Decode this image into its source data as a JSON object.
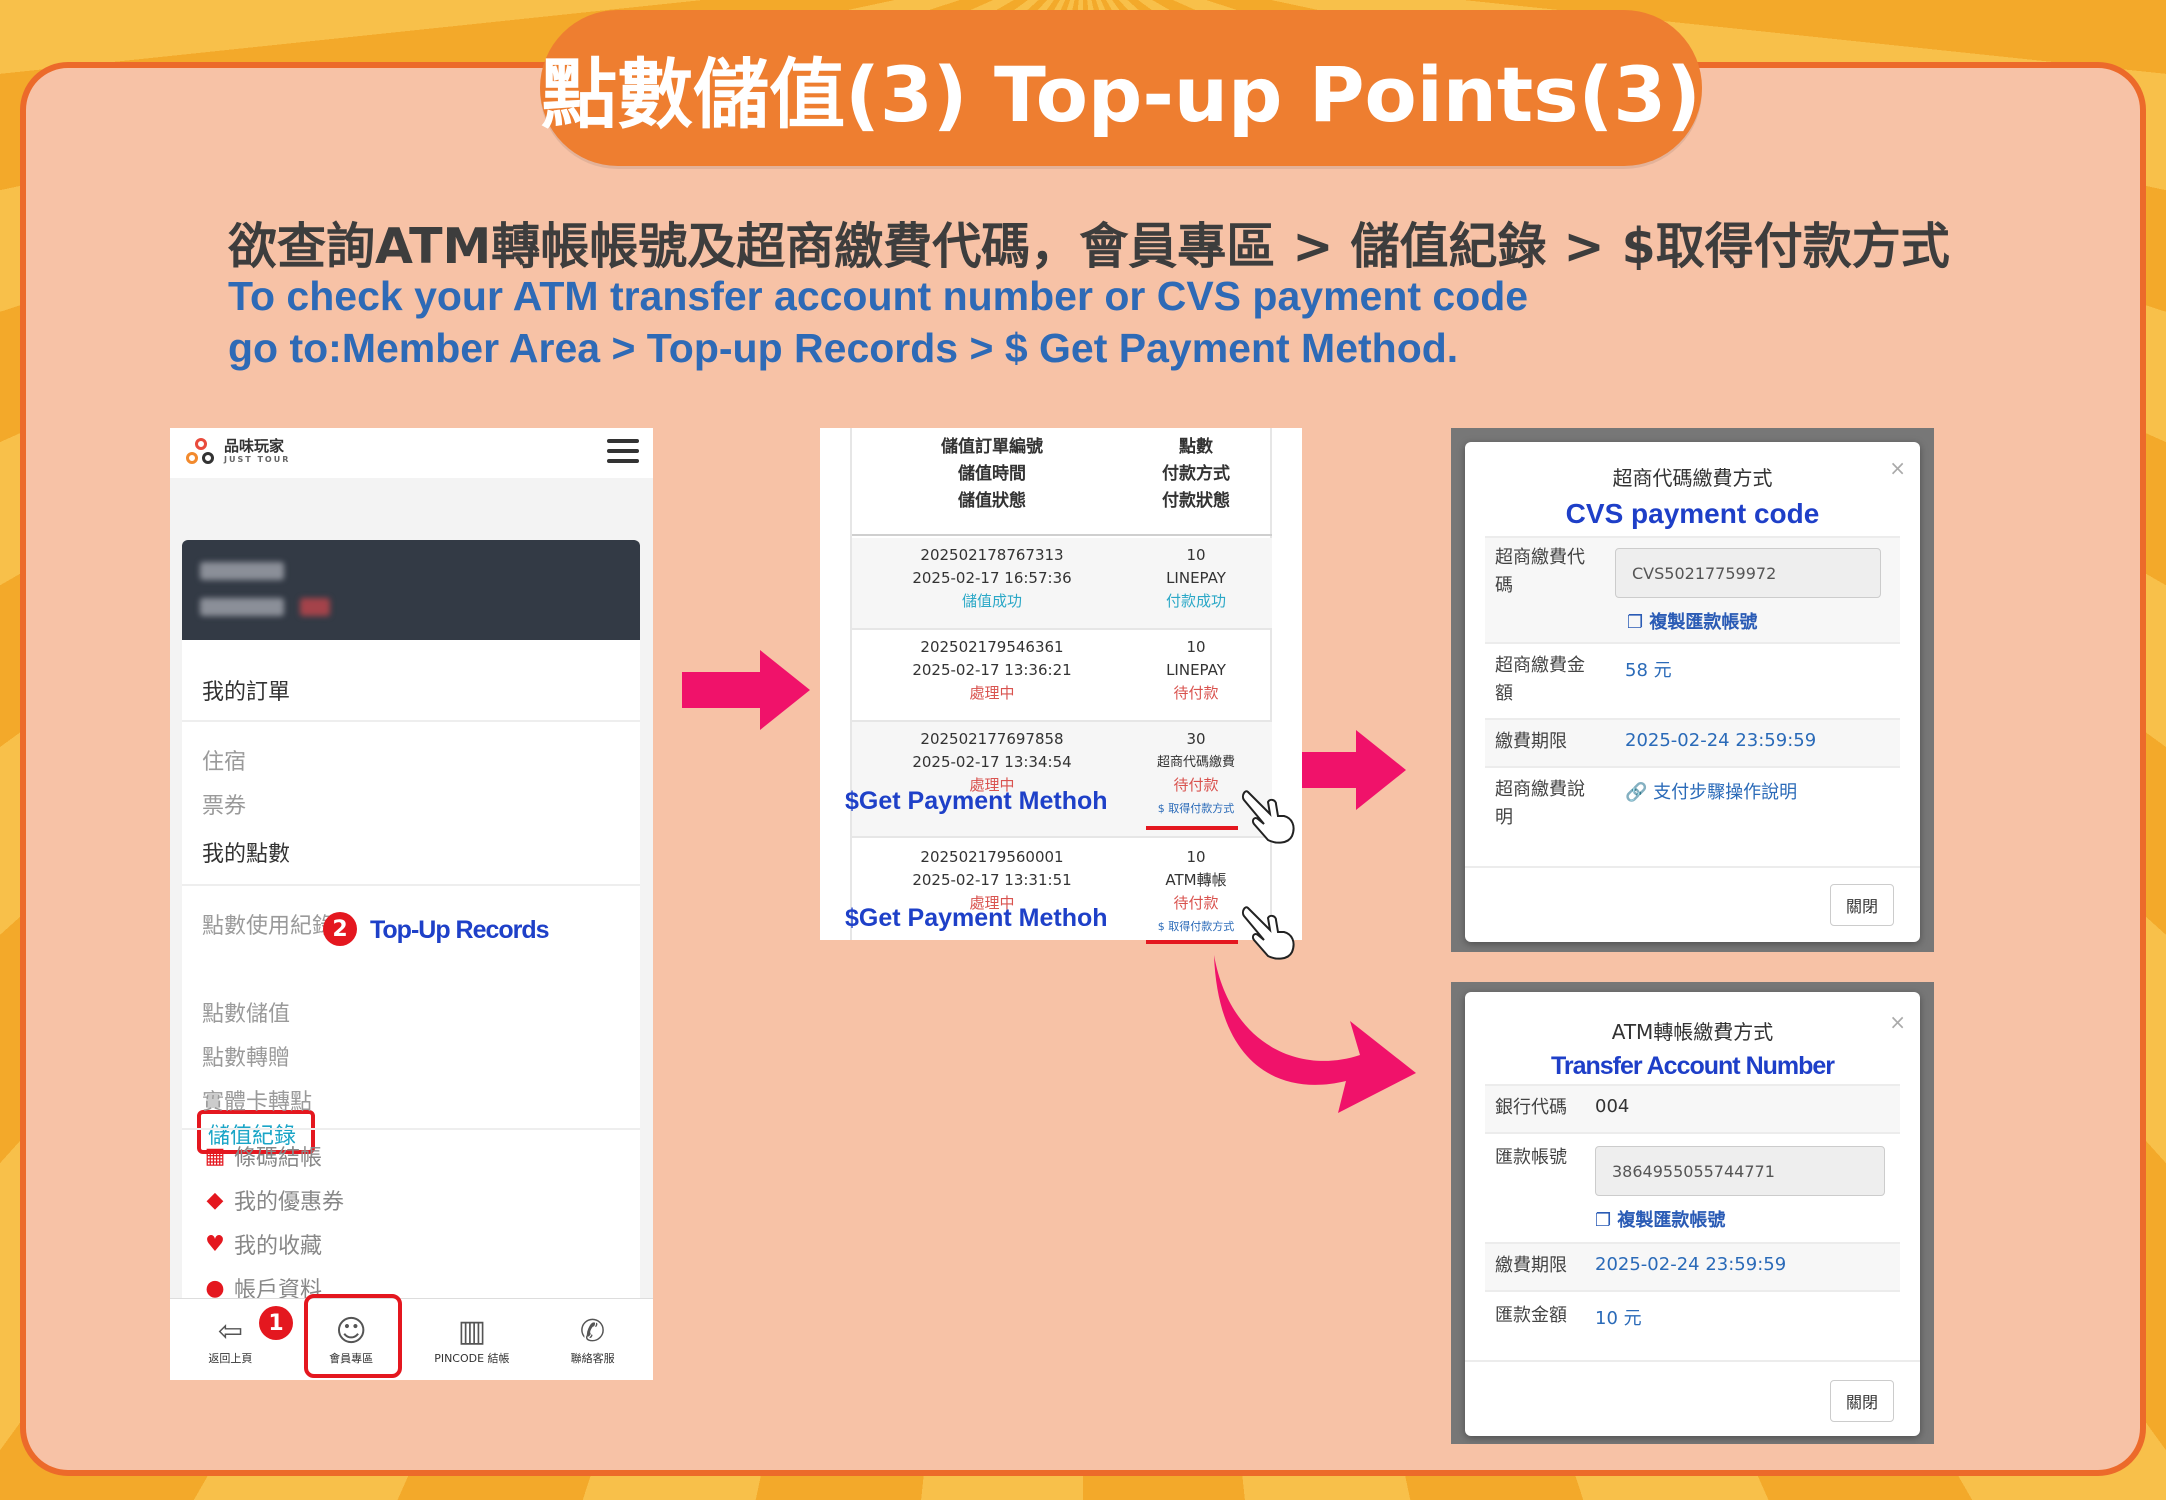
{
  "title": "點數儲值(3) Top-up Points(3)",
  "intro": {
    "zh": "欲查詢ATM轉帳帳號及超商繳費代碼，會員專區 > 儲值紀錄 > $取得付款方式",
    "en_line1": "To check your ATM transfer account number or CVS payment code",
    "en_line2": "go to:Member Area > Top-up Records > $ Get Payment Method."
  },
  "phone": {
    "logo_name": "品味玩家",
    "logo_sub": "JUST TOUR",
    "menu": {
      "my_orders": "我的訂單",
      "stay": "住宿",
      "tickets": "票券",
      "my_points": "我的點數",
      "points_usage": "點數使用紀錄",
      "topup_records": "儲值紀錄",
      "points_topup": "點數儲值",
      "points_transfer": "點數轉贈",
      "card_to_points": "實體卡轉點",
      "barcode_checkout": "條碼結帳",
      "my_coupons": "我的優惠券",
      "my_favorites": "我的收藏",
      "account_info": "帳戶資料"
    },
    "bottom_tabs": [
      "返回上頁",
      "會員專區",
      "PINCODE 結帳",
      "聯絡客服"
    ],
    "badge1": "1",
    "badge2": "2",
    "annotation_records": "Top-Up Records"
  },
  "orders": {
    "header_left": [
      "儲值訂單編號",
      "儲值時間",
      "儲值狀態"
    ],
    "header_right": [
      "點數",
      "付款方式",
      "付款狀態"
    ],
    "rows": [
      {
        "id": "202502178767313",
        "time": "2025-02-17 16:57:36",
        "status": "儲值成功",
        "points": "10",
        "method": "LINEPAY",
        "pay_status": "付款成功",
        "link": ""
      },
      {
        "id": "202502179546361",
        "time": "2025-02-17 13:36:21",
        "status": "處理中",
        "points": "10",
        "method": "LINEPAY",
        "pay_status": "待付款",
        "link": ""
      },
      {
        "id": "202502177697858",
        "time": "2025-02-17 13:34:54",
        "status": "處理中",
        "points": "30",
        "method": "超商代碼繳費",
        "pay_status": "待付款",
        "link": "$ 取得付款方式"
      },
      {
        "id": "202502179560001",
        "time": "2025-02-17 13:31:51",
        "status": "處理中",
        "points": "10",
        "method": "ATM轉帳",
        "pay_status": "待付款",
        "link": "$ 取得付款方式"
      }
    ],
    "annotation": "$Get Payment Methoh"
  },
  "cvs_modal": {
    "title": "超商代碼繳費方式",
    "close_x": "×",
    "annotation": "CVS payment code",
    "code_label": "超商繳費代碼",
    "code_value": "CVS50217759972",
    "copy": "複製匯款帳號",
    "amount_label": "超商繳費金額",
    "amount_value": "58 元",
    "deadline_label": "繳費期限",
    "deadline_value": "2025-02-24 23:59:59",
    "desc_label": "超商繳費說明",
    "desc_value": "支付步驟操作說明",
    "close_btn": "關閉"
  },
  "atm_modal": {
    "title": "ATM轉帳繳費方式",
    "close_x": "×",
    "annotation": "Transfer Account Number",
    "bank_label": "銀行代碼",
    "bank_value": "004",
    "account_label": "匯款帳號",
    "account_value": "3864955055744771",
    "copy": "複製匯款帳號",
    "deadline_label": "繳費期限",
    "deadline_value": "2025-02-24 23:59:59",
    "amount_label": "匯款金額",
    "amount_value": "10 元",
    "close_btn": "關閉"
  },
  "colors": {
    "accent": "#ee7e30",
    "annotation_blue": "#1e40c8",
    "highlight_red": "#e4171f",
    "arrow_pink": "#f0126a"
  }
}
